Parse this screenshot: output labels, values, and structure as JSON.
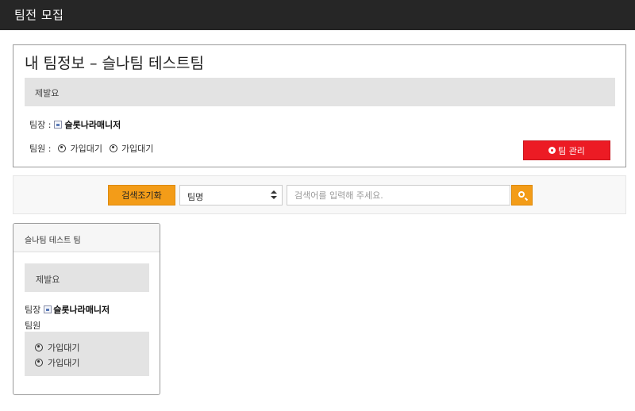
{
  "header": {
    "title": "팀전 모집"
  },
  "my_team": {
    "title": "내 팀정보 – 슬나팀 테스트팀",
    "message": "제발요",
    "leader_label": "팀장 :",
    "leader_name": "슬롯나라매니저",
    "members_label": "팀원 :",
    "members": [
      "가입대기",
      "가입대기"
    ],
    "manage_button": "팀 관리",
    "manage_button_color": "#ec1b24"
  },
  "search": {
    "reset_label": "검색조기화",
    "select_value": "팀명",
    "input_placeholder": "검색어를 입력해 주세요.",
    "accent_color": "#f39c18"
  },
  "team_list": [
    {
      "name": "슬나팀 테스트 팀",
      "message": "제발요",
      "leader_label": "팀장",
      "leader_name": "슬롯나라매니저",
      "members_label": "팀원",
      "members": [
        "가입대기",
        "가입대기"
      ]
    }
  ]
}
